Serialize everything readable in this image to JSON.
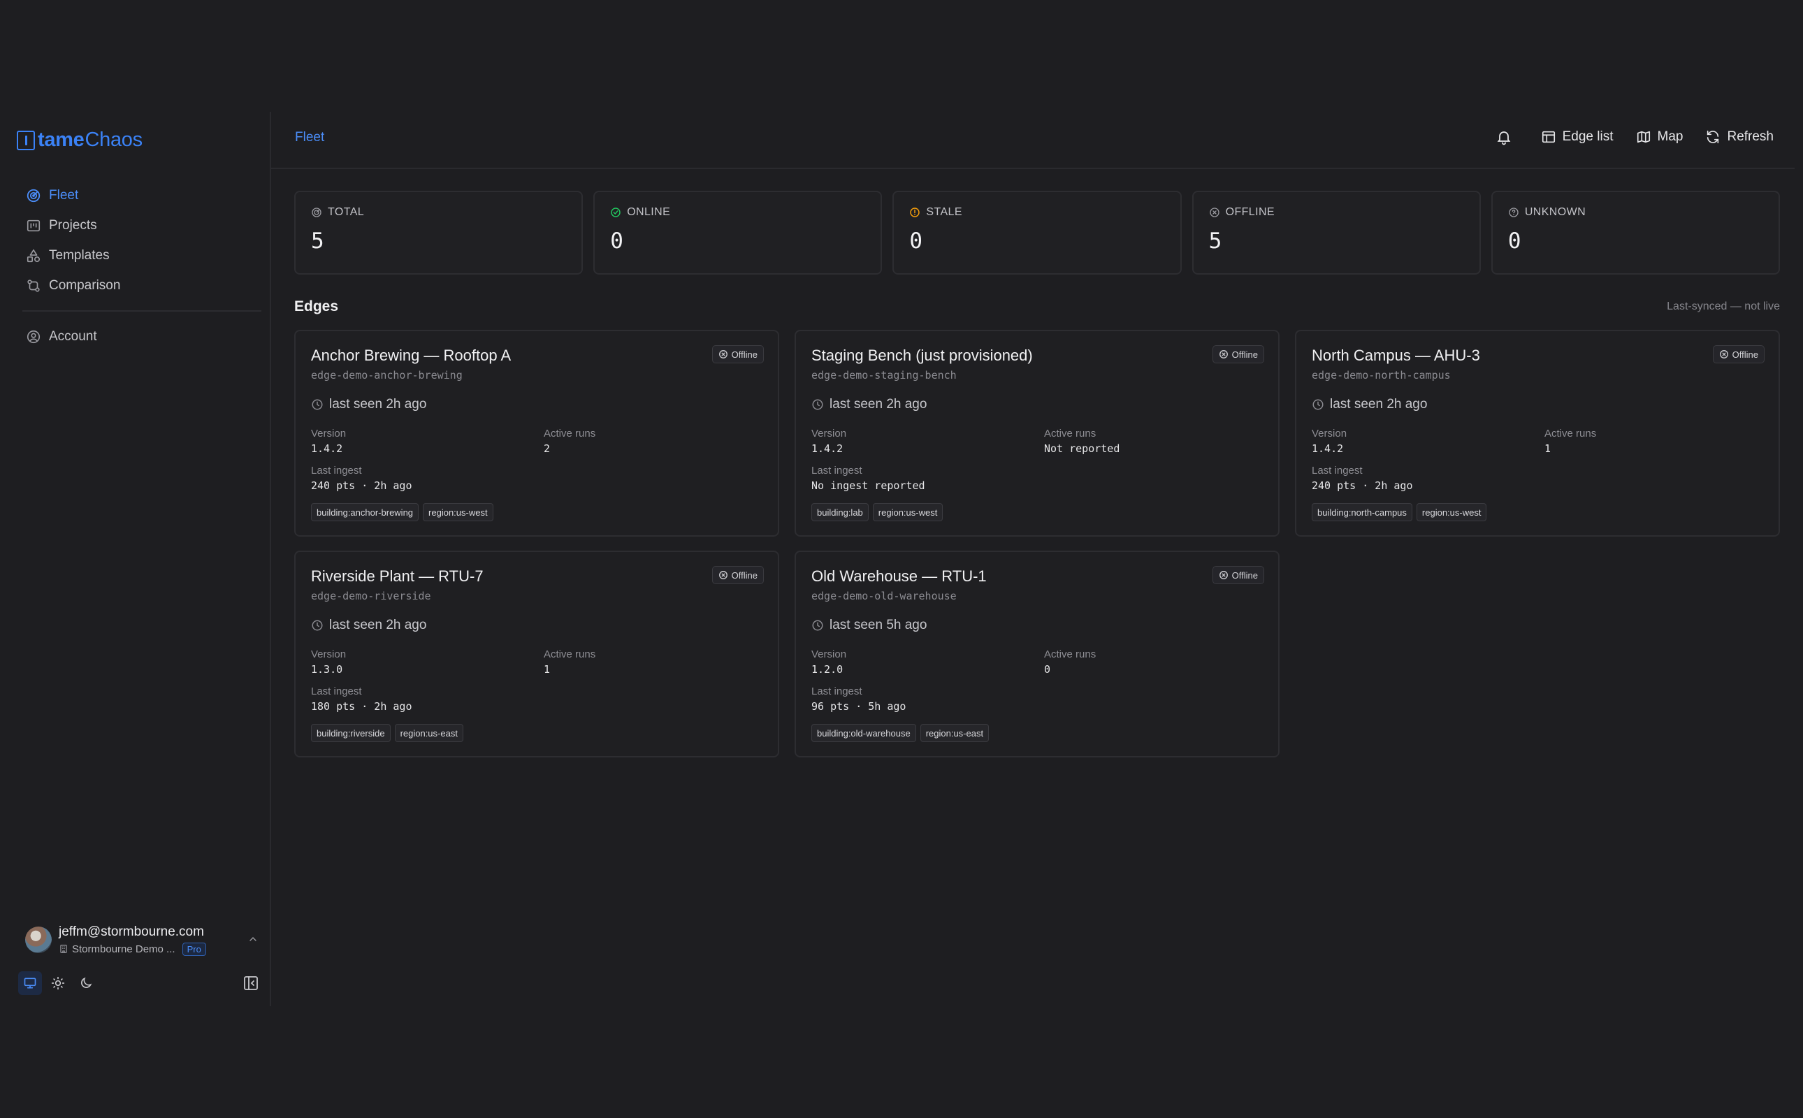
{
  "brand": {
    "bold": "tame",
    "light": "Chaos",
    "accent": "#3b82f6"
  },
  "sidebar": {
    "items": [
      {
        "label": "Fleet",
        "icon": "radar-icon",
        "active": true
      },
      {
        "label": "Projects",
        "icon": "projects-icon"
      },
      {
        "label": "Templates",
        "icon": "shapes-icon"
      },
      {
        "label": "Comparison",
        "icon": "git-compare-icon"
      }
    ],
    "account": {
      "label": "Account",
      "icon": "user-circle-icon"
    }
  },
  "user": {
    "email": "jeffm@stormbourne.com",
    "org": "Stormbourne Demo ...",
    "plan": "Pro"
  },
  "themes": [
    "monitor-icon",
    "sun-icon",
    "moon-icon"
  ],
  "header": {
    "breadcrumb": "Fleet",
    "actions": {
      "edge_list": "Edge list",
      "map": "Map",
      "refresh": "Refresh"
    }
  },
  "stats": {
    "total": {
      "label": "TOTAL",
      "value": "5"
    },
    "online": {
      "label": "ONLINE",
      "value": "0"
    },
    "stale": {
      "label": "STALE",
      "value": "0"
    },
    "offline": {
      "label": "OFFLINE",
      "value": "5"
    },
    "unknown": {
      "label": "UNKNOWN",
      "value": "0"
    }
  },
  "edges": {
    "title": "Edges",
    "sync_note": "Last-synced — not live",
    "field_labels": {
      "version": "Version",
      "active_runs": "Active runs",
      "last_ingest": "Last ingest"
    },
    "cards": [
      {
        "name": "Anchor Brewing — Rooftop A",
        "id": "edge-demo-anchor-brewing",
        "status": "Offline",
        "seen": "last seen 2h ago",
        "version": "1.4.2",
        "active_runs": "2",
        "last_ingest": "240 pts · 2h ago",
        "tags": [
          "building:anchor-brewing",
          "region:us-west"
        ]
      },
      {
        "name": "Staging Bench (just provisioned)",
        "id": "edge-demo-staging-bench",
        "status": "Offline",
        "seen": "last seen 2h ago",
        "version": "1.4.2",
        "active_runs": "Not reported",
        "last_ingest": "No ingest reported",
        "tags": [
          "building:lab",
          "region:us-west"
        ]
      },
      {
        "name": "North Campus — AHU-3",
        "id": "edge-demo-north-campus",
        "status": "Offline",
        "seen": "last seen 2h ago",
        "version": "1.4.2",
        "active_runs": "1",
        "last_ingest": "240 pts · 2h ago",
        "tags": [
          "building:north-campus",
          "region:us-west"
        ]
      },
      {
        "name": "Riverside Plant — RTU-7",
        "id": "edge-demo-riverside",
        "status": "Offline",
        "seen": "last seen 2h ago",
        "version": "1.3.0",
        "active_runs": "1",
        "last_ingest": "180 pts · 2h ago",
        "tags": [
          "building:riverside",
          "region:us-east"
        ]
      },
      {
        "name": "Old Warehouse — RTU-1",
        "id": "edge-demo-old-warehouse",
        "status": "Offline",
        "seen": "last seen 5h ago",
        "version": "1.2.0",
        "active_runs": "0",
        "last_ingest": "96 pts · 5h ago",
        "tags": [
          "building:old-warehouse",
          "region:us-east"
        ]
      }
    ]
  },
  "colors": {
    "online": "#22c55e",
    "stale": "#f59e0b",
    "muted": "#8a8a90"
  }
}
